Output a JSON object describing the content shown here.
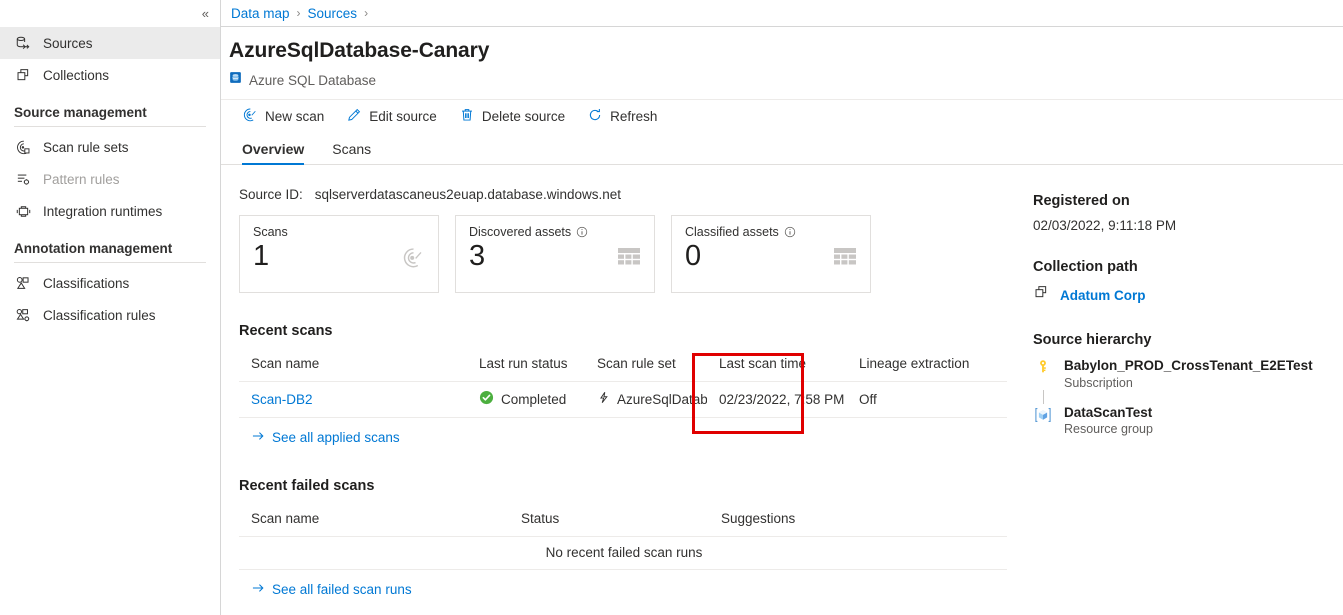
{
  "leftnav": {
    "collapse_label": "«",
    "items": [
      {
        "label": "Sources",
        "icon": "database-arrow-icon",
        "selected": true,
        "disabled": false
      },
      {
        "label": "Collections",
        "icon": "collections-icon",
        "selected": false,
        "disabled": false
      }
    ],
    "sections": [
      {
        "title": "Source management",
        "items": [
          {
            "label": "Scan rule sets",
            "icon": "scan-rule-sets-icon",
            "disabled": false
          },
          {
            "label": "Pattern rules",
            "icon": "pattern-rules-icon",
            "disabled": true
          },
          {
            "label": "Integration runtimes",
            "icon": "integration-runtimes-icon",
            "disabled": false
          }
        ]
      },
      {
        "title": "Annotation management",
        "items": [
          {
            "label": "Classifications",
            "icon": "classifications-icon",
            "disabled": false
          },
          {
            "label": "Classification rules",
            "icon": "classification-rules-icon",
            "disabled": false
          }
        ]
      }
    ]
  },
  "breadcrumb": {
    "items": [
      "Data map",
      "Sources"
    ],
    "separator": "›"
  },
  "header": {
    "title": "AzureSqlDatabase-Canary",
    "subtitle": "Azure SQL Database",
    "subtitle_icon": "azure-sql-database-icon"
  },
  "toolbar": {
    "buttons": [
      {
        "label": "New scan",
        "icon": "new-scan-icon"
      },
      {
        "label": "Edit source",
        "icon": "pencil-icon"
      },
      {
        "label": "Delete source",
        "icon": "trash-icon"
      },
      {
        "label": "Refresh",
        "icon": "refresh-icon"
      }
    ]
  },
  "tabs": [
    {
      "label": "Overview",
      "active": true
    },
    {
      "label": "Scans",
      "active": false
    }
  ],
  "overview": {
    "source_id_label": "Source ID:",
    "source_id_value": "sqlserverdatascaneus2euap.database.windows.net",
    "cards": [
      {
        "label": "Scans",
        "value": "1",
        "icon": "scan-target-icon",
        "has_info": false
      },
      {
        "label": "Discovered assets",
        "value": "3",
        "icon": "table-grid-icon",
        "has_info": true
      },
      {
        "label": "Classified assets",
        "value": "0",
        "icon": "table-grid-icon",
        "has_info": true
      }
    ],
    "recent_scans": {
      "title": "Recent scans",
      "columns": [
        "Scan name",
        "Last run status",
        "Scan rule set",
        "Last scan time",
        "Lineage extraction"
      ],
      "rows": [
        {
          "scan_name": "Scan-DB2",
          "last_run_status": "Completed",
          "status_icon": "success-check-icon",
          "scan_rule_set": "AzureSqlDataba",
          "scan_rule_set_icon": "lightning-bolt-icon",
          "last_scan_time": "02/23/2022, 7:58 PM",
          "lineage_extraction": "Off"
        }
      ],
      "see_all_label": "See all applied scans"
    },
    "recent_failed_scans": {
      "title": "Recent failed scans",
      "columns": [
        "Scan name",
        "Status",
        "Suggestions"
      ],
      "empty_message": "No recent failed scan runs",
      "see_all_label": "See all failed scan runs"
    }
  },
  "right_panel": {
    "registered_on": {
      "title": "Registered on",
      "value": "02/03/2022, 9:11:18 PM"
    },
    "collection_path": {
      "title": "Collection path",
      "name": "Adatum Corp",
      "icon": "collections-icon"
    },
    "source_hierarchy": {
      "title": "Source hierarchy",
      "items": [
        {
          "name": "Babylon_PROD_CrossTenant_E2ETest",
          "type": "Subscription",
          "icon": "key-icon"
        },
        {
          "name": "DataScanTest",
          "type": "Resource group",
          "icon": "resource-group-icon"
        }
      ]
    }
  },
  "annotation": {
    "highlight_color": "#e00000",
    "highlight_target": "last-run-status-column"
  },
  "colors": {
    "accent": "#0078d4",
    "success": "#4caf3f",
    "text": "#323130",
    "muted": "#605e5c",
    "border": "#e1dfdd",
    "key_yellow": "#ffca28"
  }
}
